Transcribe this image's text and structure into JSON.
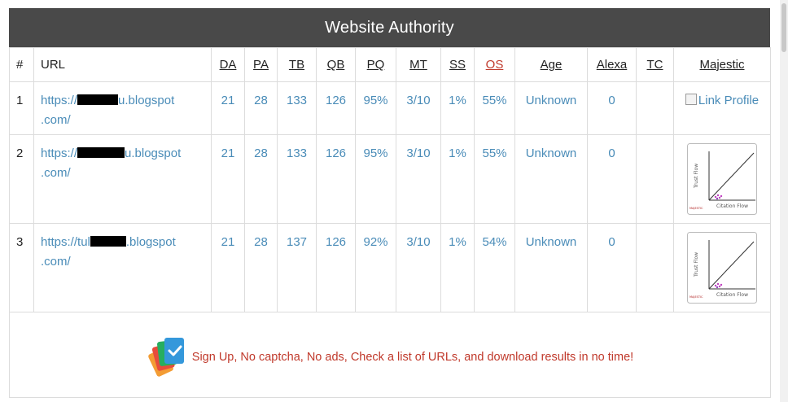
{
  "header": {
    "title": "Website Authority"
  },
  "table": {
    "columns": [
      {
        "key": "num",
        "label": "#"
      },
      {
        "key": "url",
        "label": "URL"
      },
      {
        "key": "da",
        "label": "DA"
      },
      {
        "key": "pa",
        "label": "PA"
      },
      {
        "key": "tb",
        "label": "TB"
      },
      {
        "key": "qb",
        "label": "QB"
      },
      {
        "key": "pq",
        "label": "PQ"
      },
      {
        "key": "mt",
        "label": "MT"
      },
      {
        "key": "ss",
        "label": "SS"
      },
      {
        "key": "os",
        "label": "OS"
      },
      {
        "key": "age",
        "label": "Age"
      },
      {
        "key": "alexa",
        "label": "Alexa"
      },
      {
        "key": "tc",
        "label": "TC"
      },
      {
        "key": "majestic",
        "label": "Majestic"
      }
    ],
    "rows": [
      {
        "num": "1",
        "url_prefix": "https://",
        "url_suffix": "u.blogspot",
        "url_line2": ".com/",
        "da": "21",
        "pa": "28",
        "tb": "133",
        "qb": "126",
        "pq": "95%",
        "mt": "3/10",
        "ss": "1%",
        "os": "55%",
        "age": "Unknown",
        "alexa": "0",
        "tc": "",
        "majestic_alt": "Link Profile"
      },
      {
        "num": "2",
        "url_prefix": "https://",
        "url_suffix": "u.blogspot",
        "url_line2": ".com/",
        "da": "21",
        "pa": "28",
        "tb": "133",
        "qb": "126",
        "pq": "95%",
        "mt": "3/10",
        "ss": "1%",
        "os": "55%",
        "age": "Unknown",
        "alexa": "0",
        "tc": ""
      },
      {
        "num": "3",
        "url_prefix": "https://tul",
        "url_suffix": ".blogspot",
        "url_line2": ".com/",
        "da": "21",
        "pa": "28",
        "tb": "137",
        "qb": "126",
        "pq": "92%",
        "mt": "3/10",
        "ss": "1%",
        "os": "54%",
        "age": "Unknown",
        "alexa": "0",
        "tc": ""
      }
    ],
    "graph": {
      "y_label": "Trust Flow",
      "x_label": "Citation Flow",
      "brand": "MAJESTIC"
    }
  },
  "footer": {
    "promo_text": "Sign Up, No captcha, No ads, Check a list of URLs, and download results in no time!"
  },
  "colors": {
    "header_bg": "#494949",
    "link": "#4a8cb8",
    "accent_red": "#c0392b"
  }
}
